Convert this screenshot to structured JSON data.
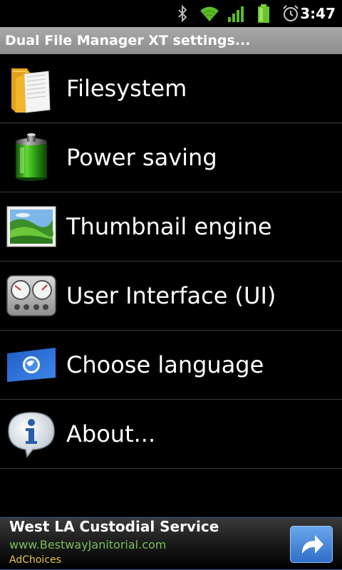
{
  "status_bar": {
    "time": "3:47",
    "icons": [
      "bluetooth-icon",
      "wifi-icon",
      "signal-icon",
      "battery-icon",
      "alarm-icon"
    ]
  },
  "title_bar": {
    "title": "Dual File Manager XT settings..."
  },
  "settings": {
    "items": [
      {
        "label": "Filesystem",
        "icon": "folder-icon"
      },
      {
        "label": "Power saving",
        "icon": "battery-icon"
      },
      {
        "label": "Thumbnail engine",
        "icon": "image-icon"
      },
      {
        "label": "User Interface (UI)",
        "icon": "gauges-icon"
      },
      {
        "label": "Choose language",
        "icon": "globe-icon"
      },
      {
        "label": "About...",
        "icon": "info-icon"
      }
    ]
  },
  "ad": {
    "headline": "West LA Custodial Service",
    "url": "www.BestwayJanitorial.com",
    "choices_label": "AdChoices",
    "button_icon": "share-arrow-icon"
  },
  "colors": {
    "title_bar_bg": "#9a9a9a",
    "ad_url": "#7bbf5a",
    "ad_choices": "#e3c84a",
    "ad_button": "#3f82d8",
    "divider": "#3a3a3a"
  }
}
